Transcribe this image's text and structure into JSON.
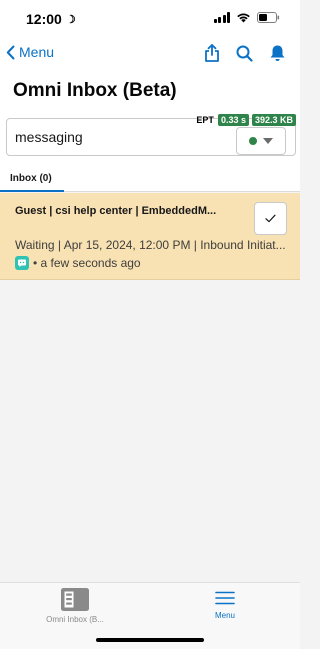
{
  "status_bar": {
    "time": "12:00"
  },
  "nav": {
    "back_label": "Menu",
    "icons": [
      "share-icon",
      "search-icon",
      "bell-icon"
    ],
    "accent_color": "#0b72c6"
  },
  "page": {
    "title": "Omni Inbox (Beta)"
  },
  "filter": {
    "search_value": "messaging",
    "status_color": "#2e844a"
  },
  "perf": {
    "label": "EPT",
    "time": "0.33 s",
    "size": "392.3 KB"
  },
  "tabs": [
    {
      "label": "Inbox (0)",
      "active": true
    }
  ],
  "work_items": [
    {
      "title": "Guest | csi help center | EmbeddedM...",
      "detail": "Waiting | Apr 15, 2024, 12:00 PM | Inbound Initiat...",
      "age": "• a few seconds ago",
      "background": "#f8e2b4",
      "channel_icon": "chat-icon"
    }
  ],
  "bottom_tabs": [
    {
      "label": "Omni Inbox (B...",
      "icon": "omni-inbox-icon"
    },
    {
      "label": "Menu",
      "icon": "hamburger-icon"
    }
  ]
}
